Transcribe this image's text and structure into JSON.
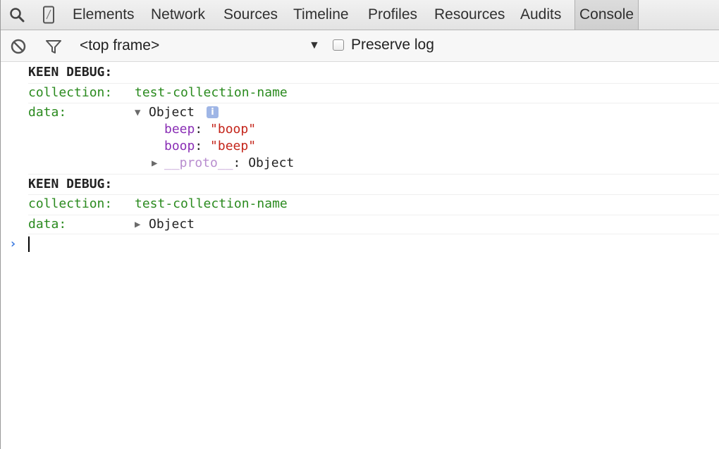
{
  "tabs": {
    "icons": [
      "search-icon",
      "device-icon"
    ],
    "items": [
      {
        "label": "Elements"
      },
      {
        "label": "Network"
      },
      {
        "label": "Sources"
      },
      {
        "label": "Timeline"
      },
      {
        "label": "Profiles"
      },
      {
        "label": "Resources"
      },
      {
        "label": "Audits"
      },
      {
        "label": "Console",
        "selected": true
      }
    ]
  },
  "toolbar": {
    "icons": [
      "clear-icon",
      "filter-icon"
    ],
    "frame_select": "<top frame>",
    "preserve_log_label": "Preserve log",
    "preserve_log_checked": false
  },
  "console": {
    "messages": [
      {
        "header": "KEEN DEBUG:",
        "collection_key": "collection:",
        "collection_value": "test-collection-name",
        "data_key": "data:",
        "object_label": "Object",
        "expanded": true,
        "properties": [
          {
            "key": "beep",
            "value": "\"boop\""
          },
          {
            "key": "boop",
            "value": "\"beep\""
          }
        ],
        "proto_key": "__proto__",
        "proto_value": ": Object"
      },
      {
        "header": "KEEN DEBUG:",
        "collection_key": "collection:",
        "collection_value": "test-collection-name",
        "data_key": "data:",
        "object_label": "Object",
        "expanded": false
      }
    ],
    "prompt_symbol": "›"
  },
  "colors": {
    "string_value": "#c4251b",
    "property_key": "#8a2fb5",
    "log_text": "#2a8a1e",
    "prompt": "#3b7ae0"
  }
}
